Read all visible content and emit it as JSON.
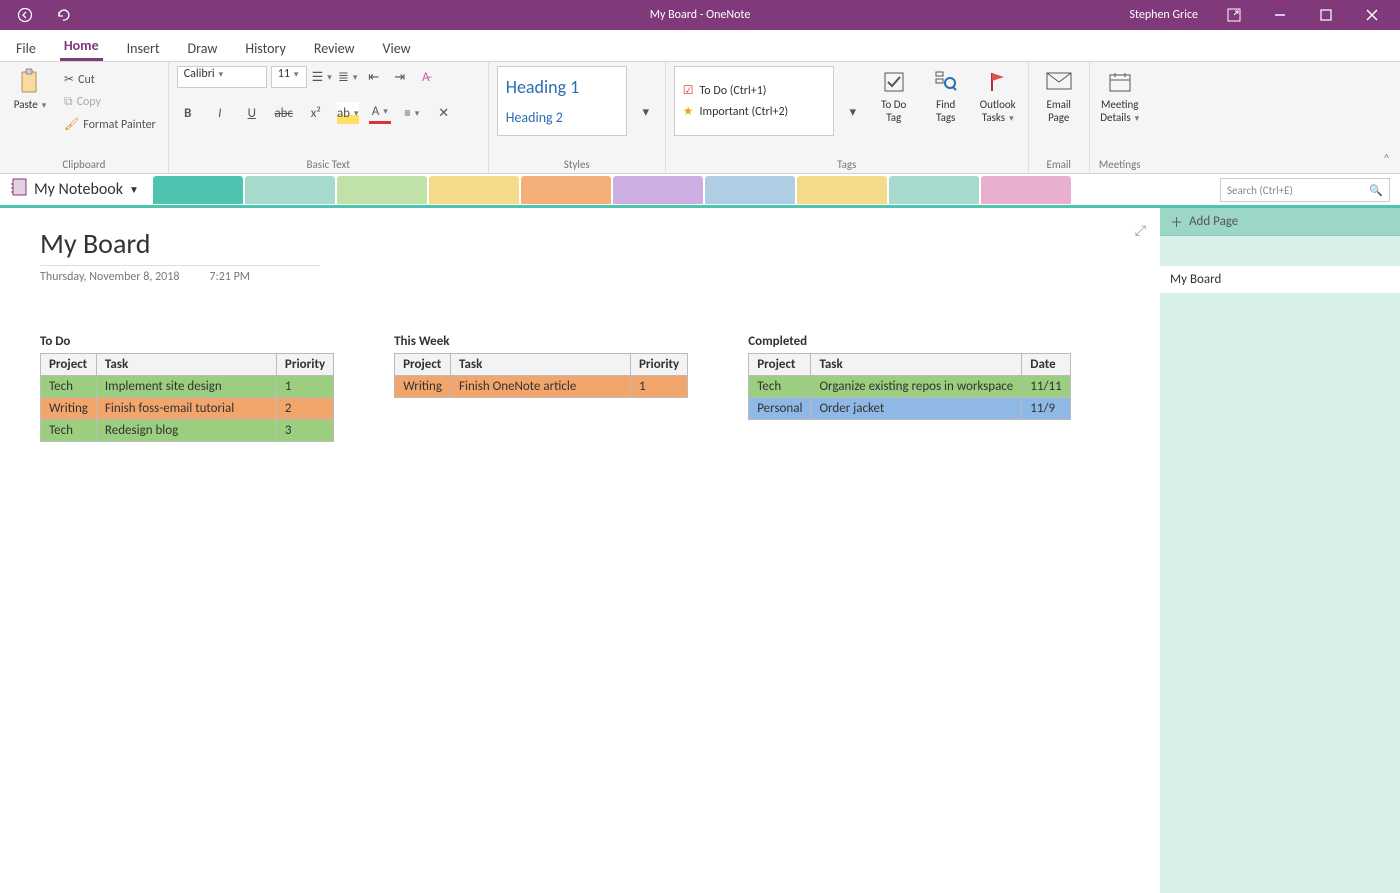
{
  "titlebar": {
    "title": "My Board  -  OneNote",
    "user": "Stephen Grice"
  },
  "ribbon_tabs": [
    "File",
    "Home",
    "Insert",
    "Draw",
    "History",
    "Review",
    "View"
  ],
  "active_tab": "Home",
  "clipboard": {
    "paste": "Paste",
    "cut": "Cut",
    "copy": "Copy",
    "fmt": "Format Painter",
    "group": "Clipboard"
  },
  "basic_text": {
    "font": "Calibri",
    "size": "11",
    "group": "Basic Text"
  },
  "styles": {
    "h1": "Heading 1",
    "h2": "Heading 2",
    "group": "Styles"
  },
  "tags": {
    "todo": "To Do (Ctrl+1)",
    "important": "Important (Ctrl+2)",
    "tdtag": "To Do Tag",
    "find": "Find Tags",
    "outlook": "Outlook Tasks",
    "group": "Tags"
  },
  "email": {
    "btn": "Email Page",
    "group": "Email"
  },
  "meetings": {
    "btn": "Meeting Details",
    "group": "Meetings"
  },
  "notebook": {
    "name": "My Notebook"
  },
  "section_colors": [
    "#4ec3b0",
    "#9bd6c6",
    "#b9df9e",
    "#f3d77f",
    "#f3a66b",
    "#c9a6e0",
    "#a6c9e0",
    "#f3d77f",
    "#9bd6c6",
    "#e6a6c9"
  ],
  "search": {
    "placeholder": "Search (Ctrl+E)"
  },
  "page": {
    "title": "My Board",
    "date": "Thursday, November 8, 2018",
    "time": "7:21 PM"
  },
  "boards": {
    "todo": {
      "title": "To Do",
      "cols": [
        "Project",
        "Task",
        "Priority"
      ],
      "rows": [
        {
          "c": [
            "Tech",
            "Implement site design",
            "1"
          ],
          "cls": "row-green"
        },
        {
          "c": [
            "Writing",
            "Finish foss-email tutorial",
            "2"
          ],
          "cls": "row-orange"
        },
        {
          "c": [
            "Tech",
            "Redesign blog",
            "3"
          ],
          "cls": "row-green"
        }
      ]
    },
    "week": {
      "title": "This Week",
      "cols": [
        "Project",
        "Task",
        "Priority"
      ],
      "rows": [
        {
          "c": [
            "Writing",
            "Finish OneNote article",
            "1"
          ],
          "cls": "row-orange"
        }
      ]
    },
    "done": {
      "title": "Completed",
      "cols": [
        "Project",
        "Task",
        "Date"
      ],
      "rows": [
        {
          "c": [
            "Tech",
            "Organize existing repos in workspace",
            "11/11"
          ],
          "cls": "row-green"
        },
        {
          "c": [
            "Personal",
            "Order jacket",
            "11/9"
          ],
          "cls": "row-blue"
        }
      ]
    }
  },
  "pagepane": {
    "add": "Add Page",
    "pages": [
      "My Board"
    ]
  }
}
